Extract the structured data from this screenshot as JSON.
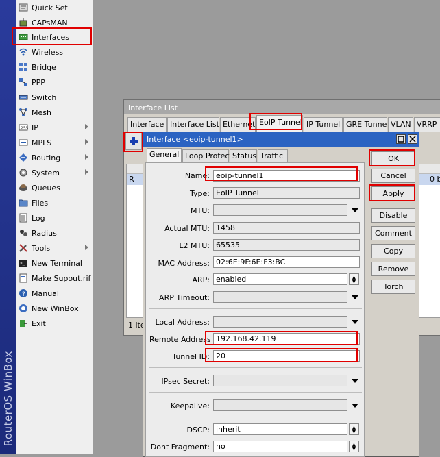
{
  "brand": "RouterOS WinBox",
  "sidebar": {
    "items": [
      {
        "label": "Quick Set",
        "icon": "quickset-icon",
        "submenu": false
      },
      {
        "label": "CAPsMAN",
        "icon": "capsman-icon",
        "submenu": false
      },
      {
        "label": "Interfaces",
        "icon": "interfaces-icon",
        "submenu": false
      },
      {
        "label": "Wireless",
        "icon": "wireless-icon",
        "submenu": false
      },
      {
        "label": "Bridge",
        "icon": "bridge-icon",
        "submenu": false
      },
      {
        "label": "PPP",
        "icon": "ppp-icon",
        "submenu": false
      },
      {
        "label": "Switch",
        "icon": "switch-icon",
        "submenu": false
      },
      {
        "label": "Mesh",
        "icon": "mesh-icon",
        "submenu": false
      },
      {
        "label": "IP",
        "icon": "ip-icon",
        "submenu": true
      },
      {
        "label": "MPLS",
        "icon": "mpls-icon",
        "submenu": true
      },
      {
        "label": "Routing",
        "icon": "routing-icon",
        "submenu": true
      },
      {
        "label": "System",
        "icon": "system-icon",
        "submenu": true
      },
      {
        "label": "Queues",
        "icon": "queues-icon",
        "submenu": false
      },
      {
        "label": "Files",
        "icon": "files-icon",
        "submenu": false
      },
      {
        "label": "Log",
        "icon": "log-icon",
        "submenu": false
      },
      {
        "label": "Radius",
        "icon": "radius-icon",
        "submenu": false
      },
      {
        "label": "Tools",
        "icon": "tools-icon",
        "submenu": true
      },
      {
        "label": "New Terminal",
        "icon": "terminal-icon",
        "submenu": false
      },
      {
        "label": "Make Supout.rif",
        "icon": "supout-icon",
        "submenu": false
      },
      {
        "label": "Manual",
        "icon": "manual-icon",
        "submenu": false
      },
      {
        "label": "New WinBox",
        "icon": "winbox-icon",
        "submenu": false
      },
      {
        "label": "Exit",
        "icon": "exit-icon",
        "submenu": false
      }
    ]
  },
  "interface_list": {
    "title": "Interface List",
    "tabs": [
      "Interface",
      "Interface List",
      "Ethernet",
      "EoIP Tunnel",
      "IP Tunnel",
      "GRE Tunnel",
      "VLAN",
      "VRRP"
    ],
    "active_tab": "EoIP Tunnel",
    "row_flag": "R",
    "row_value": "0 b",
    "status": "1 ite"
  },
  "dialog": {
    "title": "Interface <eoip-tunnel1>",
    "tabs": [
      "General",
      "Loop Protect",
      "Status",
      "Traffic"
    ],
    "active_tab": "General",
    "fields": {
      "name": {
        "label": "Name:",
        "value": "eoip-tunnel1"
      },
      "type": {
        "label": "Type:",
        "value": "EoIP Tunnel"
      },
      "mtu": {
        "label": "MTU:",
        "value": ""
      },
      "actual_mtu": {
        "label": "Actual MTU:",
        "value": "1458"
      },
      "l2mtu": {
        "label": "L2 MTU:",
        "value": "65535"
      },
      "mac": {
        "label": "MAC Address:",
        "value": "02:6E:9F:6E:F3:BC"
      },
      "arp": {
        "label": "ARP:",
        "value": "enabled"
      },
      "arp_timeout": {
        "label": "ARP Timeout:",
        "value": ""
      },
      "local_address": {
        "label": "Local Address:",
        "value": ""
      },
      "remote_address": {
        "label": "Remote Address:",
        "value": "192.168.42.119"
      },
      "tunnel_id": {
        "label": "Tunnel ID:",
        "value": "20"
      },
      "ipsec_secret": {
        "label": "IPsec Secret:",
        "value": ""
      },
      "keepalive": {
        "label": "Keepalive:",
        "value": ""
      },
      "dscp": {
        "label": "DSCP:",
        "value": "inherit"
      },
      "dont_fragment": {
        "label": "Dont Fragment:",
        "value": "no"
      }
    },
    "buttons": {
      "ok": "OK",
      "cancel": "Cancel",
      "apply": "Apply",
      "disable": "Disable",
      "comment": "Comment",
      "copy": "Copy",
      "remove": "Remove",
      "torch": "Torch"
    }
  },
  "colors": {
    "brand_strip": "#2a3b9c",
    "title_active": "#2b63c2",
    "highlight": "#e00000"
  }
}
